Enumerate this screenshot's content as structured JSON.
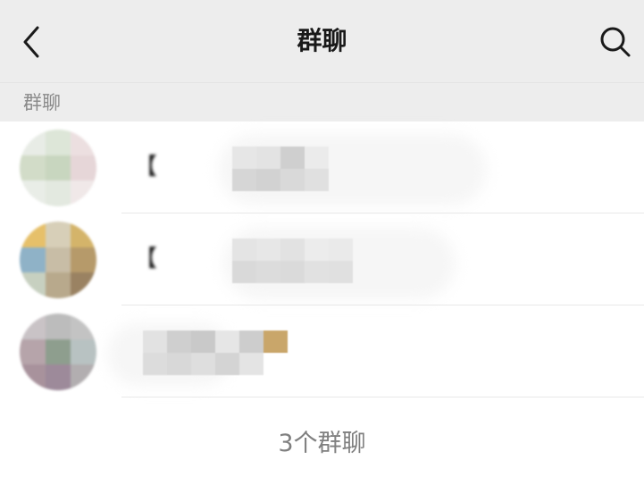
{
  "header": {
    "title": "群聊",
    "back_icon": "chevron-left-icon",
    "search_icon": "search-icon"
  },
  "section": {
    "label": "群聊"
  },
  "groups": [
    {
      "name_visible": "【",
      "avatar_colors": [
        "#e8ece6",
        "#dde6d8",
        "#ecdfe0",
        "#d2dcc8",
        "#c8d6bf",
        "#e6d6d8",
        "#e9ede7",
        "#e3e9e0",
        "#f0e8e8"
      ],
      "mosaic_colors": [
        "#e6e6e6",
        "#d6d6d6",
        "#e3e3e3",
        "#d2d2d2",
        "#cfcfcf",
        "#d9d9d9",
        "#ebebeb",
        "#e0e0e0"
      ]
    },
    {
      "name_visible": "【",
      "avatar_colors": [
        "#e6c06a",
        "#d7cfb8",
        "#d4b46a",
        "#8fb2c7",
        "#c8bda6",
        "#b69a6a",
        "#c7d0c0",
        "#b8a98c",
        "#9a8262"
      ],
      "mosaic_colors": [
        "#e4e4e4",
        "#d9d9d9",
        "#e7e7e7",
        "#dcdcdc",
        "#e2e2e2",
        "#dadada",
        "#ececec",
        "#e1e1e1",
        "#eaeaea",
        "#e0e0e0"
      ]
    },
    {
      "name_visible": "",
      "avatar_colors": [
        "#c9c3c6",
        "#bcbcbc",
        "#c3c3c3",
        "#b6a4aa",
        "#8e9e8e",
        "#b8c2c2",
        "#a8929c",
        "#9d8a9a",
        "#b2aeb0"
      ],
      "mosaic_colors": [
        "#e2e2e2",
        "#dcdcdc",
        "#cfcfcf",
        "#d8d8d8",
        "#c9c9c9",
        "#dedede",
        "#e6e6e6",
        "#d4d4d4",
        "#cdcdcd",
        "#e4e4e4",
        "#c9a66a"
      ]
    }
  ],
  "footer": {
    "count_text": "3个群聊"
  }
}
